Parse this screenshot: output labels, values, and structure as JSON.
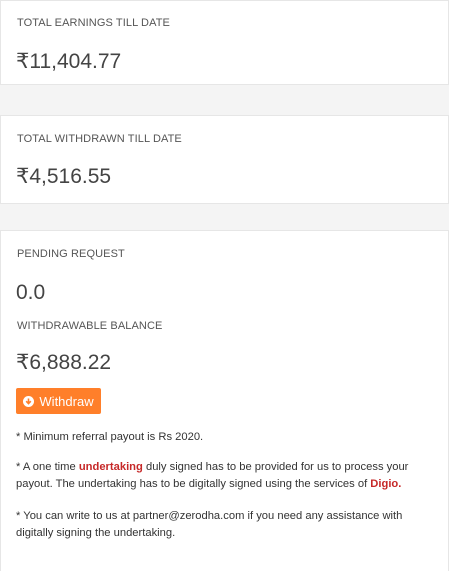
{
  "earnings": {
    "label": "TOTAL EARNINGS TILL DATE",
    "amount": "₹11,404.77"
  },
  "withdrawn": {
    "label": "TOTAL WITHDRAWN TILL DATE",
    "amount": "₹4,516.55"
  },
  "pending": {
    "label": "PENDING REQUEST",
    "amount": "0.0",
    "withdrawable_label": "WITHDRAWABLE BALANCE",
    "withdrawable_amount": "₹6,888.22",
    "withdraw_button": "Withdraw",
    "withdraw_icon": "arrow-down-circle-icon",
    "button_color": "#ff7f2a"
  },
  "notes": {
    "min_payout": "* Minimum referral payout is Rs 2020.",
    "undertaking_pre": "* A one time ",
    "undertaking_word": "undertaking",
    "undertaking_mid": " duly signed has to be provided for us to process your payout. The undertaking has to be digitally signed using the services of ",
    "digio": "Digio.",
    "contact": "* You can write to us at partner@zerodha.com if you need any assistance with digitally signing the undertaking.",
    "highlight_color": "#c62828"
  }
}
